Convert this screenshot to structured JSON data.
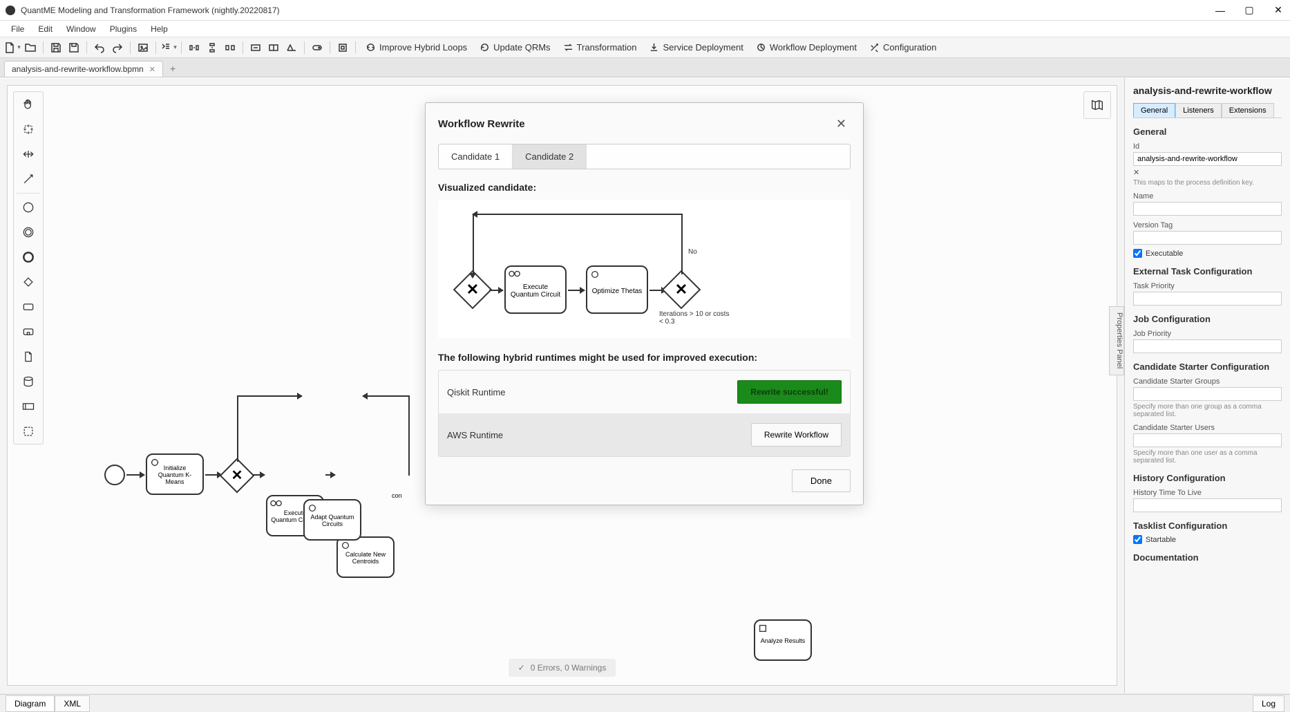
{
  "window": {
    "title": "QuantME Modeling and Transformation Framework (nightly.20220817)"
  },
  "menu": {
    "file": "File",
    "edit": "Edit",
    "window": "Window",
    "plugins": "Plugins",
    "help": "Help"
  },
  "toolbar_labeled": {
    "improve": "Improve Hybrid Loops",
    "update": "Update QRMs",
    "transform": "Transformation",
    "service": "Service Deployment",
    "workflow": "Workflow Deployment",
    "config": "Configuration"
  },
  "tabs": {
    "file": "analysis-and-rewrite-workflow.bpmn"
  },
  "bottom": {
    "diagram": "Diagram",
    "xml": "XML",
    "log": "Log"
  },
  "errors_badge": "0 Errors, 0 Warnings",
  "canvas_nodes": {
    "init": "Initialize Quantum K-Means",
    "exec": "Execute Quantum Circuits",
    "calc": "Calculate New Centroids",
    "adapt": "Adapt Quantum Circuits",
    "analyze": "Analyze Results",
    "con_label": "con"
  },
  "props_collapse": "Properties Panel",
  "props": {
    "title": "analysis-and-rewrite-workflow",
    "tabs": {
      "general": "General",
      "listeners": "Listeners",
      "extensions": "Extensions"
    },
    "general": "General",
    "id_label": "Id",
    "id_value": "analysis-and-rewrite-workflow",
    "id_hint": "This maps to the process definition key.",
    "name_label": "Name",
    "version_label": "Version Tag",
    "executable": "Executable",
    "ext_task": "External Task Configuration",
    "task_priority": "Task Priority",
    "job_conf": "Job Configuration",
    "job_priority": "Job Priority",
    "cand_starter": "Candidate Starter Configuration",
    "cand_groups": "Candidate Starter Groups",
    "cand_groups_hint": "Specify more than one group as a comma separated list.",
    "cand_users": "Candidate Starter Users",
    "cand_users_hint": "Specify more than one user as a comma separated list.",
    "history": "History Configuration",
    "history_ttl": "History Time To Live",
    "tasklist": "Tasklist Configuration",
    "startable": "Startable",
    "documentation": "Documentation"
  },
  "modal": {
    "title": "Workflow Rewrite",
    "tab1": "Candidate 1",
    "tab2": "Candidate 2",
    "viz_label": "Visualized candidate:",
    "runtimes_label": "The following hybrid runtimes might be used for improved execution:",
    "runtimes": [
      {
        "name": "Qiskit Runtime",
        "button": "Rewrite successful!",
        "success": true
      },
      {
        "name": "AWS Runtime",
        "button": "Rewrite Workflow",
        "success": false
      }
    ],
    "done": "Done",
    "cand": {
      "exec": "Execute Quantum Circuit",
      "opt": "Optimize Thetas",
      "no": "No",
      "cond": "Iterations > 10 or costs < 0.3"
    }
  }
}
